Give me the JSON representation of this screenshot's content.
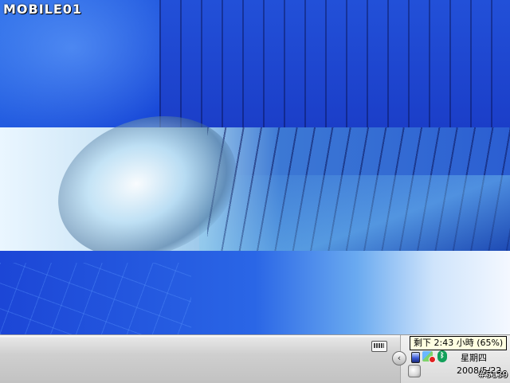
{
  "wallpaper": {
    "logo_text": "MOBILE01"
  },
  "taskbar": {
    "keyboard_icon": "keyboard-icon",
    "tooltip_text": "剩下 2:43 小時 (65%)",
    "back_button_glyph": "‹",
    "tray_icons": [
      "battery-icon",
      "network-icon",
      "bluetooth-icon",
      "touch-icon"
    ],
    "bluetooth_glyph": "ᛒ",
    "weekday": "星期四",
    "date": "2008/5/22",
    "watermark": "#5139"
  }
}
